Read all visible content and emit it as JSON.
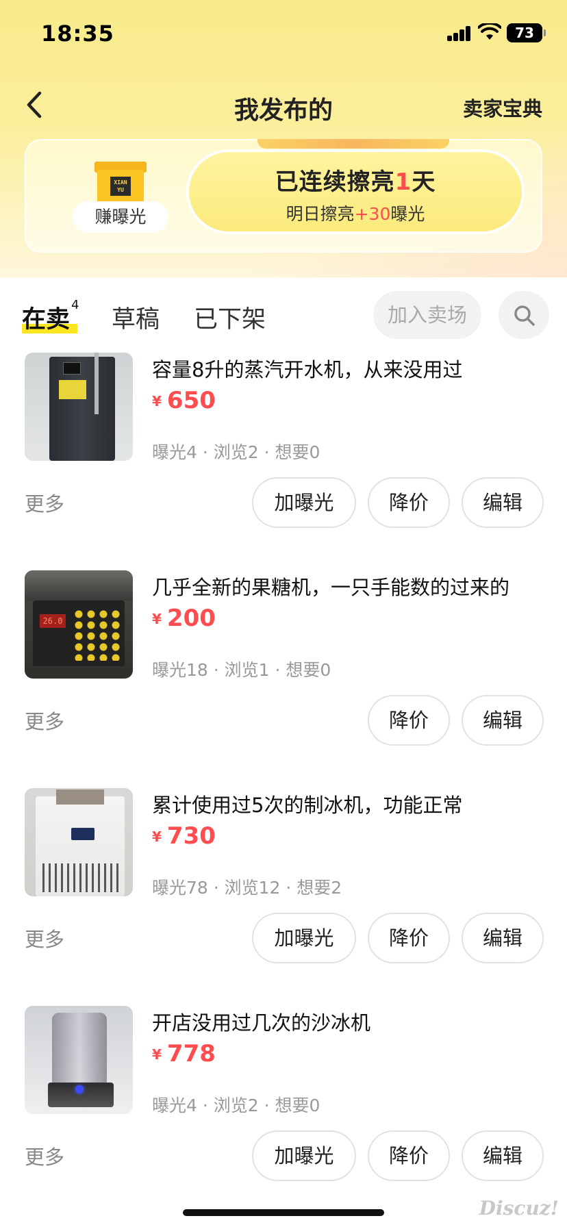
{
  "status_bar": {
    "time": "18:35",
    "battery": "73"
  },
  "nav": {
    "title": "我发布的",
    "right_link": "卖家宝典"
  },
  "streak": {
    "box_logo": "XIAN YU",
    "earn_label": "赚曝光",
    "line1_prefix": "已连续擦亮",
    "line1_days": "1",
    "line1_suffix": "天",
    "line2_prefix": "明日擦亮",
    "line2_bonus": "+30",
    "line2_suffix": "曝光"
  },
  "tabs": [
    {
      "label": "在卖",
      "count": "4"
    },
    {
      "label": "草稿"
    },
    {
      "label": "已下架"
    }
  ],
  "join_label": "加入卖场",
  "items": [
    {
      "title": "容量8升的蒸汽开水机，从来没用过",
      "currency": "¥",
      "price": "650",
      "stats": "曝光4 · 浏览2 · 想要0",
      "more": "更多",
      "boost": "加曝光",
      "reduce": "降价",
      "edit": "编辑",
      "thumb_label": ""
    },
    {
      "title": "几乎全新的果糖机，一只手能数的过来的",
      "currency": "¥",
      "price": "200",
      "stats": "曝光18 · 浏览1 · 想要0",
      "more": "更多",
      "reduce": "降价",
      "edit": "编辑",
      "thumb_label": "26.0"
    },
    {
      "title": "累计使用过5次的制冰机，功能正常",
      "currency": "¥",
      "price": "730",
      "stats": "曝光78 · 浏览12 · 想要2",
      "more": "更多",
      "boost": "加曝光",
      "reduce": "降价",
      "edit": "编辑"
    },
    {
      "title": "开店没用过几次的沙冰机",
      "currency": "¥",
      "price": "778",
      "stats": "曝光4 · 浏览2 · 想要0",
      "more": "更多",
      "boost": "加曝光",
      "reduce": "降价",
      "edit": "编辑"
    }
  ],
  "watermark": "Discuz!"
}
